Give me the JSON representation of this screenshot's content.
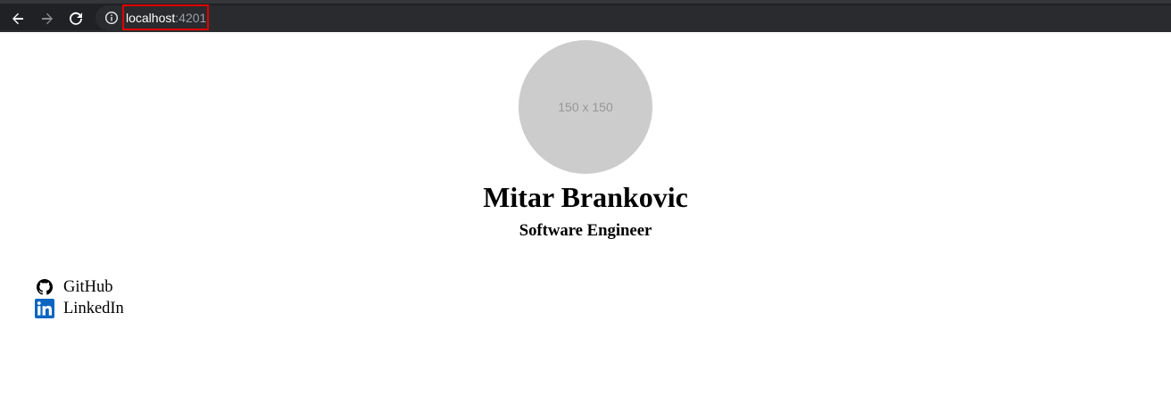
{
  "browser": {
    "url_host": "localhost",
    "url_port": ":4201"
  },
  "profile": {
    "avatar_placeholder": "150 x 150",
    "name": "Mitar Brankovic",
    "role": "Software Engineer"
  },
  "links": [
    {
      "label": "GitHub",
      "icon": "github-icon"
    },
    {
      "label": "LinkedIn",
      "icon": "linkedin-icon",
      "color": "#0a66c2"
    }
  ]
}
